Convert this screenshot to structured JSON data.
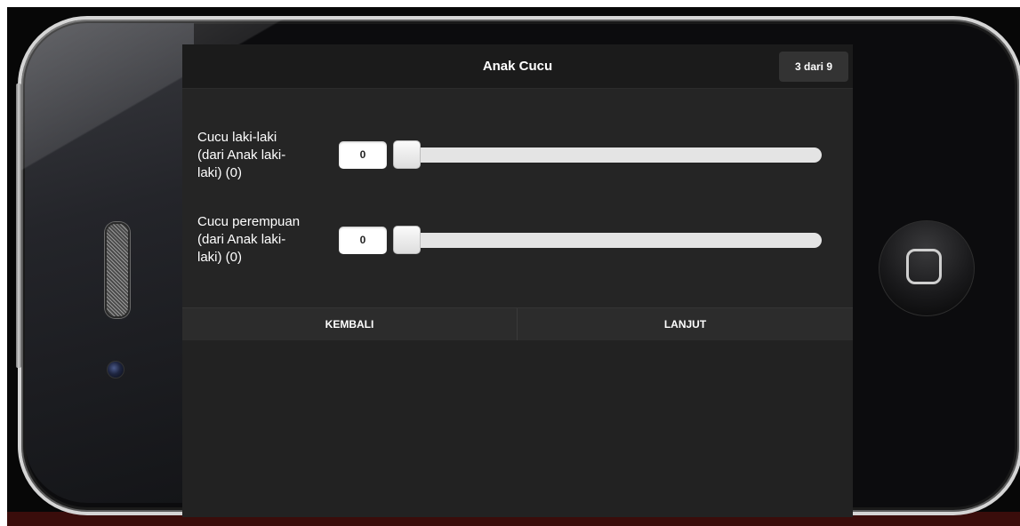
{
  "header": {
    "title": "Anak Cucu",
    "step_badge": "3 dari 9"
  },
  "fields": [
    {
      "label_line1": "Cucu laki-laki",
      "label_line2": "(dari Anak laki-",
      "label_line3": "laki) (0)",
      "value": "0",
      "slider_fraction": 0
    },
    {
      "label_line1": "Cucu perempuan",
      "label_line2": "(dari Anak laki-",
      "label_line3": "laki) (0)",
      "value": "0",
      "slider_fraction": 0
    }
  ],
  "nav": {
    "back_label": "KEMBALI",
    "next_label": "LANJUT"
  },
  "colors": {
    "screen_background": "#252525",
    "header_background": "#1b1b1b",
    "button_bar": "#2c2c2c",
    "slider_track": "#e4e4e4"
  }
}
